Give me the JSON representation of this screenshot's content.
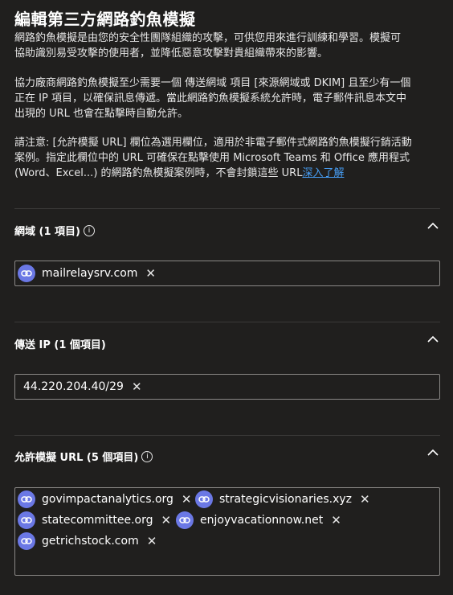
{
  "title": "編輯第三方網路釣魚模擬",
  "intro": "網路釣魚模擬是由您的安全性團隊組織的攻擊，可供您用來進行訓練和學習。模擬可\n協助識別易受攻擊的使用者，並降低惡意攻擊對貴組織帶來的影響。",
  "requirement": "協力廠商網路釣魚模擬至少需要一個 傳送網域 項目 [來源網域或 DKIM] 且至少有一個\n正在 IP 項目，以確保訊息傳遞。當此網路釣魚模擬系統允許時，電子郵件訊息本文中\n出現的 URL 也會在點擊時自動允許。",
  "note": "請注意: [允許模擬 URL] 欄位為選用欄位，適用於非電子郵件式網路釣魚模擬行銷活動\n案例。指定此欄位中的 URL 可確保在點擊使用 Microsoft Teams 和 Office 應用程式\n(Word、Excel...) 的網路釣魚模擬案例時，不會封鎖這些 URL",
  "learn_more": "深入了解",
  "sections": {
    "domains": {
      "title": "網域 (1 項目)",
      "items": [
        "mailrelaysrv.com"
      ]
    },
    "ips": {
      "title": "傳送 IP (1 個項目)",
      "items": [
        "44.220.204.40/29"
      ]
    },
    "urls": {
      "title": "允許模擬 URL (5 個項目)",
      "items": [
        "govimpactanalytics.org",
        "strategicvisionaries.xyz",
        "statecommittee.org",
        "enjoyvacationnow.net",
        "getrichstock.com"
      ]
    }
  },
  "icons": {
    "chip": "link-icon",
    "remove": "close-icon",
    "info": "info-icon",
    "collapse": "chevron-up-icon"
  },
  "colors": {
    "background": "#201f1e",
    "chip_icon": "#6b78e5",
    "link": "#479ef5"
  }
}
